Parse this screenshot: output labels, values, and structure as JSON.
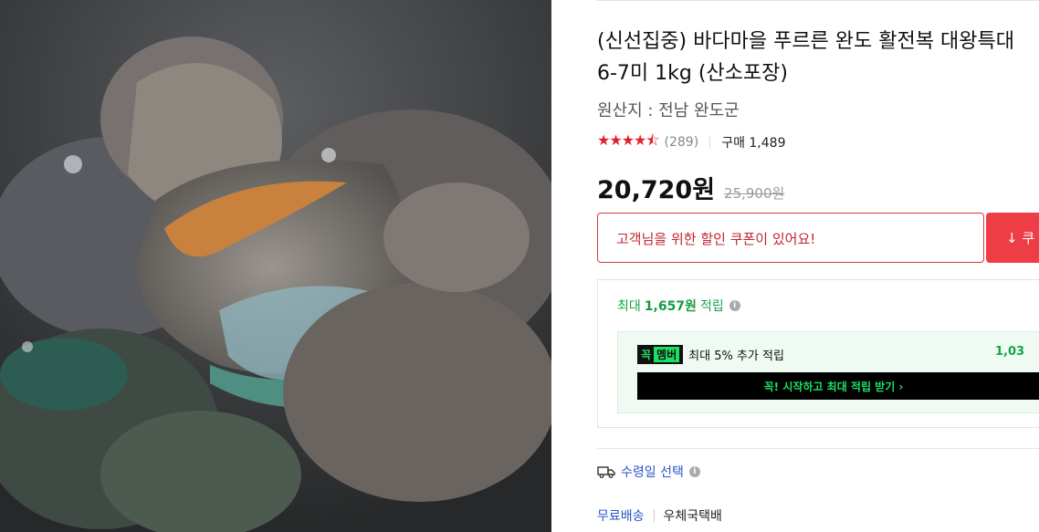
{
  "product": {
    "title": "(신선집중) 바다마을 푸르른 완도 활전복 대왕특대 6-7미 1kg (산소포장)",
    "origin": "원산지 : 전남 완도군",
    "rating_stars": 4.5,
    "review_count": "(289)",
    "purchase": "구매 1,489",
    "price": "20,720원",
    "original_price": "25,900원",
    "image_alt": "abalone-photo"
  },
  "coupon": {
    "text": "고객님을 위한 할인 쿠폰이 있어요!",
    "button": "↓ 쿠"
  },
  "reward": {
    "prefix": "최대",
    "amount": "1,657원",
    "suffix": "적립",
    "member_badge": "꼭",
    "member_badge_tag": "멤버",
    "member_text": "최대 5% 추가 적립",
    "member_amount": "1,03",
    "member_cta": "꼭! 시작하고 최대 적립 받기 ›"
  },
  "delivery": {
    "label": "수령일 선택",
    "shipping_free": "무료배송",
    "carrier": "우체국택배"
  },
  "colors": {
    "accent_red": "#ef3d45",
    "green": "#1aa34a",
    "link_blue": "#2a56c6"
  },
  "icons": [
    "star-icon",
    "info-icon",
    "download-icon",
    "truck-icon"
  ]
}
